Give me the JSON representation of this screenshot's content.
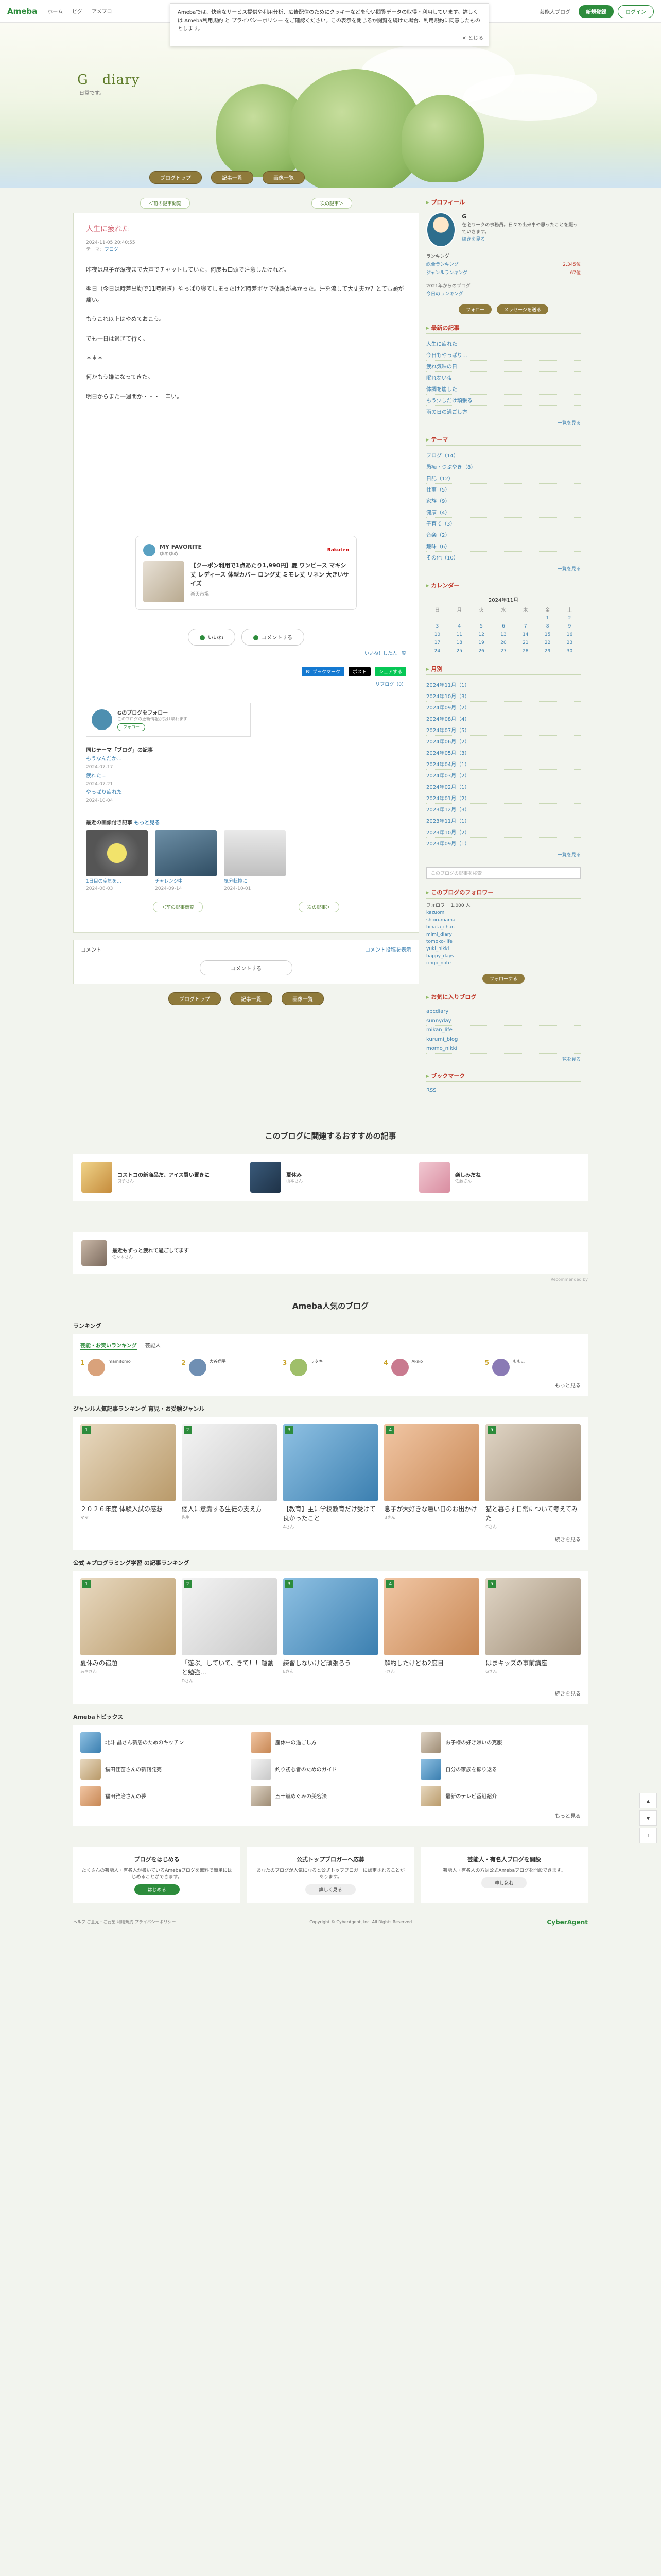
{
  "topbar": {
    "logo": "Ameba",
    "nav": [
      "ホーム",
      "ピグ",
      "アメブロ"
    ],
    "right_link": "芸能人ブログ",
    "signup": "新規登録",
    "login": "ログイン"
  },
  "cookie": {
    "text": "Amebaでは、快適なサービス提供や利用分析、広告配信のためにクッキーなどを使い閲覧データの取得・利用しています。詳しくは Ameba利用規約 と プライバシーポリシー をご確認ください。この表示を閉じるか閲覧を続けた場合、利用規約に同意したものとします。",
    "close": "とじる"
  },
  "header": {
    "title": "G　diary",
    "subtitle": "日常です。",
    "nav": [
      "ブログトップ",
      "記事一覧",
      "画像一覧"
    ]
  },
  "subnav": {
    "prev": "＜前の記事閲覧",
    "next": "次の記事＞"
  },
  "entry": {
    "title": "人生に疲れた",
    "date": "2024-11-05 20:40:55",
    "theme_label": "テーマ：",
    "theme": "ブログ",
    "paragraphs": [
      "昨夜は息子が深夜まで大声でチャットしていた。何度も口頭で注意したけれど。",
      "翌日（今日は時差出勤で11時過ぎ）やっぱり寝てしまったけど時差ボケで体調が悪かった。汗を流して大丈夫か？とても頭が痛い。",
      "もうこれ以上はやめておこう。",
      "でも一日は過ぎて行く。",
      "＊＊＊",
      "何かもう嫌になってきた。",
      "明日からまた一週間か・・・　辛い。"
    ]
  },
  "favorite": {
    "heading": "MY FAVORITE",
    "user": "ゆめゆめ",
    "brand": "Rakuten",
    "item_title": "【クーポン利用で1点あたり1,990円】夏 ワンピース マキシ丈 レディース 体型カバー ロング丈 ミモレ丈 リネン 大きいサイズ",
    "shop": "楽天市場"
  },
  "actions": {
    "like": "いいね",
    "comment": "コメントする",
    "like_link": "いいね！した人一覧"
  },
  "share": {
    "hatena": "B! ブックマーク",
    "x": "ポスト",
    "line": "シェアする",
    "reblog": "リブログ（0）"
  },
  "author": {
    "name": "Gのブログをフォロー",
    "desc": "このブログの更新情報が受け取れます",
    "follow": "フォロー"
  },
  "same_theme": {
    "heading": "同じテーマ「ブログ」の記事",
    "items": [
      {
        "title": "もうなんだか…",
        "date": "2024-07-17"
      },
      {
        "title": "疲れた…",
        "date": "2024-07-21"
      },
      {
        "title": "やっぱり疲れた",
        "date": "2024-10-04"
      }
    ]
  },
  "recent": {
    "heading": "最近の画像付き記事",
    "more": "もっと見る",
    "items": [
      {
        "title": "1日目の空気を…",
        "date": "2024-08-03"
      },
      {
        "title": "チャレンジ中",
        "date": "2024-09-14"
      },
      {
        "title": "気分転換に",
        "date": "2024-10-01"
      }
    ]
  },
  "bottom_nav": {
    "prev": "＜前の記事閲覧",
    "next": "次の記事＞"
  },
  "comment": {
    "heading": "コメント",
    "link": "コメント投稿を表示",
    "button": "コメントする"
  },
  "sidebar": {
    "profile_heading": "プロフィール",
    "profile_name": "G",
    "profile_desc": "在宅ワークの事務員。日々の出来事や思ったことを綴っていきます。",
    "profile_more": "続きを見る",
    "ranking_label": "ランキング",
    "ranking": [
      {
        "label": "総合ランキング",
        "value": "2,345位"
      },
      {
        "label": "ジャンルランキング",
        "value": "67位"
      }
    ],
    "since": "2021年からのブログ",
    "since_rank": "今日のランキング",
    "follow_btn": "フォロー",
    "msg_btn": "メッセージを送る",
    "recent_heading": "最新の記事",
    "recent": [
      "人生に疲れた",
      "今日もやっぱり…",
      "疲れ気味の日",
      "眠れない夜",
      "体調を崩した",
      "もう少しだけ頑張る",
      "雨の日の過ごし方"
    ],
    "recent_more": "一覧を見る",
    "theme_heading": "テーマ",
    "themes": [
      "ブログ（14）",
      "愚痴・つぶやき（8）",
      "日記（12）",
      "仕事（5）",
      "家族（9）",
      "健康（4）",
      "子育て（3）",
      "音楽（2）",
      "趣味（6）",
      "その他（10）"
    ],
    "theme_more": "一覧を見る",
    "calendar_heading": "カレンダー",
    "calendar_month": "2024年11月",
    "calendar_days": [
      "日",
      "月",
      "火",
      "水",
      "木",
      "金",
      "土"
    ],
    "calendar_weeks": [
      [
        "",
        "",
        "",
        "",
        "",
        "1",
        "2"
      ],
      [
        "3",
        "4",
        "5",
        "6",
        "7",
        "8",
        "9"
      ],
      [
        "10",
        "11",
        "12",
        "13",
        "14",
        "15",
        "16"
      ],
      [
        "17",
        "18",
        "19",
        "20",
        "21",
        "22",
        "23"
      ],
      [
        "24",
        "25",
        "26",
        "27",
        "28",
        "29",
        "30"
      ]
    ],
    "archive_heading": "月別",
    "archives": [
      "2024年11月（1）",
      "2024年10月（3）",
      "2024年09月（2）",
      "2024年08月（4）",
      "2024年07月（5）",
      "2024年06月（2）",
      "2024年05月（3）",
      "2024年04月（1）",
      "2024年03月（2）",
      "2024年02月（1）",
      "2024年01月（2）",
      "2023年12月（3）",
      "2023年11月（1）",
      "2023年10月（2）",
      "2023年09月（1）"
    ],
    "archive_more": "一覧を見る",
    "search_placeholder": "このブログの記事を検索",
    "followers_heading": "このブログのフォロワー",
    "followers_count": "フォロワー 1,000 人",
    "followers": [
      "kazuomi",
      "shiori-mama",
      "hinata_chan",
      "mimi_diary",
      "tomoko-life",
      "yuki_nikki",
      "happy_days",
      "ringo_note"
    ],
    "follow_cta": "フォローする",
    "bookmarks_heading": "お気に入りブログ",
    "bookmarks": [
      "abcdiary",
      "sunnyday",
      "mikan_life",
      "kurumi_blog",
      "momo_nikki"
    ],
    "bookmark_more": "一覧を見る",
    "book_heading": "ブックマーク",
    "book_item": "RSS"
  },
  "recommend": {
    "heading": "このブログに関連するおすすめの記事",
    "items": [
      {
        "title": "コストコの新商品だ、アイス買い置きに",
        "meta": "良子さん"
      },
      {
        "title": "夏休み",
        "meta": "山本さん"
      },
      {
        "title": "楽しみだね",
        "meta": "佐藤さん"
      }
    ],
    "single": {
      "title": "最近もずっと疲れて過ごしてます",
      "meta": "佐々木さん"
    },
    "ad_note": "Recommended by"
  },
  "popular": {
    "heading": "Ameba人気のブログ",
    "ranking_label": "ランキング",
    "tabs": [
      "芸能・お笑いランキング",
      "芸能人"
    ],
    "rank_cards": [
      {
        "rank": "1",
        "name": "mamitomo"
      },
      {
        "rank": "2",
        "name": "大谷翔平"
      },
      {
        "rank": "3",
        "name": "ワタキ"
      },
      {
        "rank": "4",
        "name": "Akiko"
      },
      {
        "rank": "5",
        "name": "ももこ"
      }
    ],
    "more": "もっと見る",
    "genre_heading": "ジャンル人気記事ランキング 育児・お受験ジャンル",
    "genre_items": [
      {
        "rank": "1",
        "title": "２０２６年度 体験入試の感想",
        "author": "ママ"
      },
      {
        "rank": "2",
        "title": "個人に意識する生徒の支え方",
        "author": "先生"
      },
      {
        "rank": "3",
        "title": "【教育】主に学校教育だけ受けて良かったこと",
        "author": "Aさん"
      },
      {
        "rank": "4",
        "title": "息子が大好きな暑い日のお出かけ",
        "author": "Bさん"
      },
      {
        "rank": "5",
        "title": "猫と暮らす日常について考えてみた",
        "author": "Cさん"
      }
    ],
    "genre_more": "続きを見る",
    "official_heading": "公式 #プログラミング学習 の記事ランキング",
    "official_items": [
      {
        "rank": "1",
        "title": "夏休みの宿題",
        "author": "あやさん"
      },
      {
        "rank": "2",
        "title": "「遊ぶ」していて、きて！！運動と勉強…",
        "author": "Dさん"
      },
      {
        "rank": "3",
        "title": "練習しないけど頑張ろう",
        "author": "Eさん"
      },
      {
        "rank": "4",
        "title": "解約したけどね2度目",
        "author": "Fさん"
      },
      {
        "rank": "5",
        "title": "はまキッズの事前講座",
        "author": "Gさん"
      }
    ],
    "official_more": "続きを見る",
    "topics_heading": "Amebaトピックス",
    "topics": [
      "北斗 晶さん新居のためのキッチン",
      "産休中の過ごし方",
      "お子様の好き嫌いの克服",
      "猫田佳苗さんの新刊発売",
      "釣り初心者のためのガイド",
      "自分の家族を振り返る",
      "福田雅治さんの夢",
      "五十嵐めぐみの美容法",
      "最新のテレビ番組紹介"
    ],
    "topics_more": "もっと見る"
  },
  "promo": [
    {
      "title": "ブログをはじめる",
      "desc": "たくさんの芸能人・有名人が書いているAmebaブログを無料で簡単にはじめることができます。",
      "btn": "はじめる"
    },
    {
      "title": "公式トップブロガーへ応募",
      "desc": "あなたのブログが人気になると公式トップブロガーに認定されることがあります。",
      "btn": "詳しく見る"
    },
    {
      "title": "芸能人・有名人ブログを開設",
      "desc": "芸能人・有名人の方は公式Amebaブログを開設できます。",
      "btn": "申し込む"
    }
  ],
  "footer": {
    "links": "ヘルプ ご意見・ご要望 利用規約 プライバシーポリシー",
    "copyright": "Copyright © CyberAgent, Inc. All Rights Reserved.",
    "company": "CyberAgent"
  },
  "colors": {
    "accent": "#2d8c3c",
    "title": "#d15b6a",
    "header_button": "#8f7a3b"
  }
}
